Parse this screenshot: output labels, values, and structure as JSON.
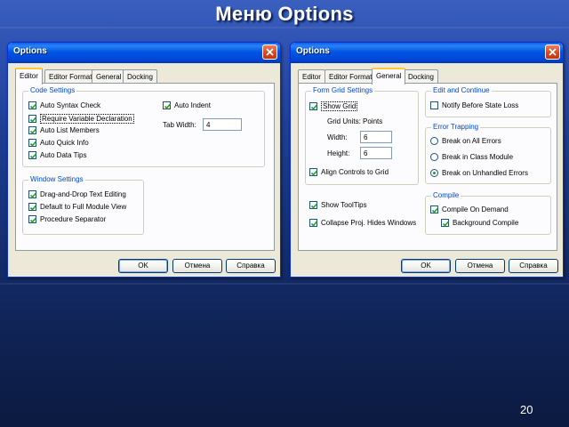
{
  "slide": {
    "title": "Меню Options",
    "page_number": "20"
  },
  "dialogs": [
    {
      "title": "Options",
      "tabs": [
        "Editor",
        "Editor Format",
        "General",
        "Docking"
      ],
      "active_tab": "Editor",
      "code_settings": {
        "label": "Code Settings",
        "options": [
          {
            "label": "Auto Syntax Check",
            "checked": true
          },
          {
            "label": "Require Variable Declaration",
            "checked": true
          },
          {
            "label": "Auto List Members",
            "checked": true
          },
          {
            "label": "Auto Quick Info",
            "checked": true
          },
          {
            "label": "Auto Data Tips",
            "checked": true
          }
        ],
        "auto_indent": {
          "label": "Auto Indent",
          "checked": true
        },
        "tab_width": {
          "label": "Tab Width:",
          "value": "4"
        }
      },
      "window_settings": {
        "label": "Window Settings",
        "options": [
          {
            "label": "Drag-and-Drop Text Editing",
            "checked": true
          },
          {
            "label": "Default to Full Module View",
            "checked": true
          },
          {
            "label": "Procedure Separator",
            "checked": true
          }
        ]
      },
      "buttons": {
        "ok": "OK",
        "cancel": "Отмена",
        "help": "Справка"
      }
    },
    {
      "title": "Options",
      "tabs": [
        "Editor",
        "Editor Format",
        "General",
        "Docking"
      ],
      "active_tab": "General",
      "form_grid": {
        "label": "Form Grid Settings",
        "show_grid": {
          "label": "Show Grid",
          "checked": true
        },
        "grid_units": "Grid Units: Points",
        "width": {
          "label": "Width:",
          "value": "6"
        },
        "height": {
          "label": "Height:",
          "value": "6"
        },
        "align": {
          "label": "Align Controls to Grid",
          "checked": true
        }
      },
      "misc": [
        {
          "label": "Show ToolTips",
          "checked": true
        },
        {
          "label": "Collapse Proj. Hides Windows",
          "checked": true
        }
      ],
      "edit_continue": {
        "label": "Edit and Continue",
        "notify": {
          "label": "Notify Before State Loss",
          "checked": false
        }
      },
      "error_trapping": {
        "label": "Error Trapping",
        "options": [
          {
            "label": "Break on All Errors",
            "selected": false
          },
          {
            "label": "Break in Class Module",
            "selected": false
          },
          {
            "label": "Break on Unhandled Errors",
            "selected": true
          }
        ]
      },
      "compile": {
        "label": "Compile",
        "on_demand": {
          "label": "Compile On Demand",
          "checked": true
        },
        "background": {
          "label": "Background Compile",
          "checked": true
        }
      },
      "buttons": {
        "ok": "OK",
        "cancel": "Отмена",
        "help": "Справка"
      }
    }
  ],
  "colors": {
    "titlebar": "#0055e3",
    "group_label": "#0046d5",
    "dialog_face": "#ece9d8",
    "close_button": "#d6461f"
  },
  "icons": {
    "check": "check-icon",
    "close": "close-icon"
  }
}
